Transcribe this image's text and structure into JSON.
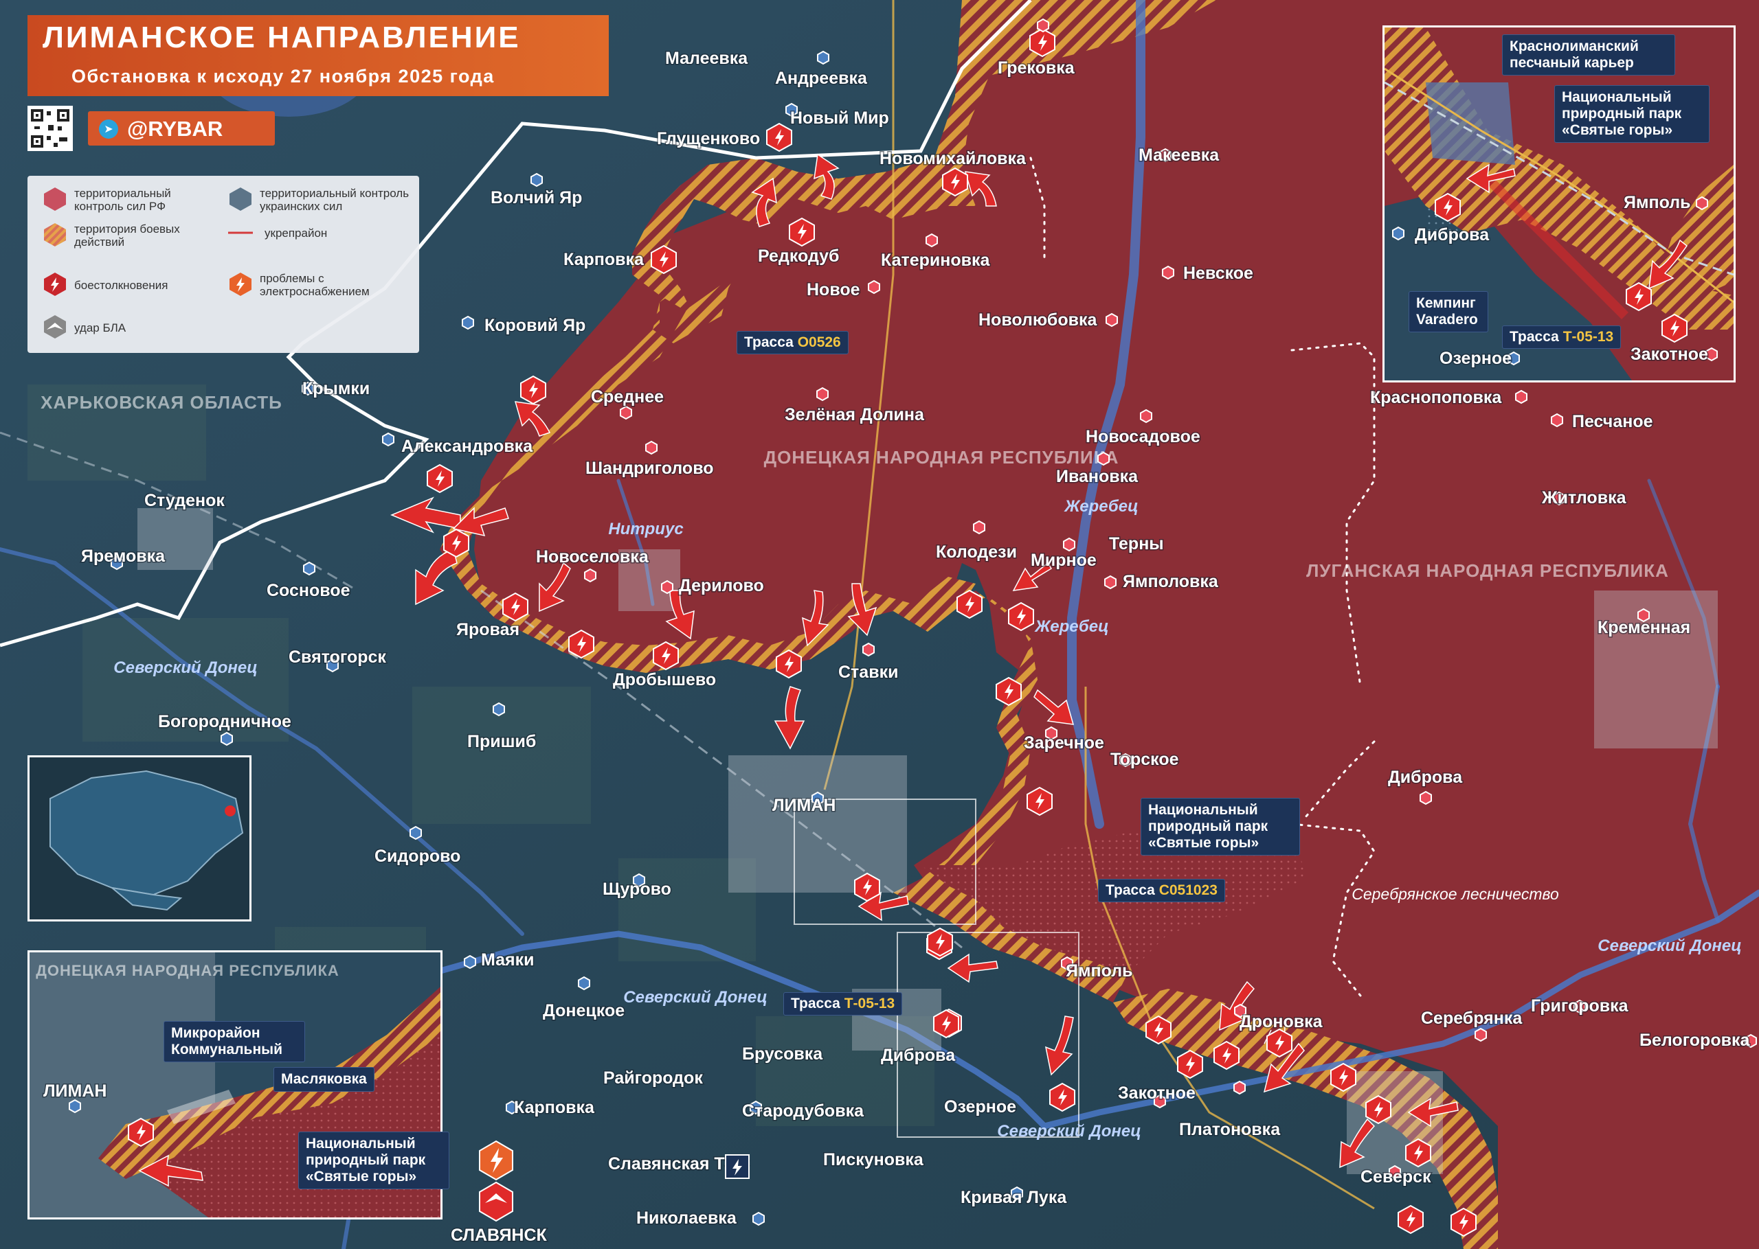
{
  "title": {
    "main": "ЛИМАНСКОЕ НАПРАВЛЕНИЕ",
    "subtitle": "Обстановка к исходу 27 ноября 2025 года",
    "brand": "@RYBAR"
  },
  "legend": {
    "ru_control": "территориальный контроль сил РФ",
    "ua_control": "территориальный контроль украинских сил",
    "combat": "территория боевых действий",
    "fortified": "укрепрайон",
    "clashes": "боестолкновения",
    "power": "проблемы с электроснабжением",
    "drone": "удар БЛА"
  },
  "colors": {
    "ru_fill": "#8b2e36",
    "ua_fill": "#2b4a5e",
    "combat_stripe": "#e0a040",
    "accent": "#d5562a",
    "clash_red": "#e02a2a"
  },
  "regions": [
    "ХАРЬКОВСКАЯ ОБЛАСТЬ",
    "ДОНЕЦКАЯ НАРОДНАЯ РЕСПУБЛИКА",
    "ЛУГАНСКАЯ НАРОДНАЯ РЕСПУБЛИКА"
  ],
  "rivers": [
    "Нитриус",
    "Жеребец",
    "Жеребец",
    "Северский Донец",
    "Северский Донец",
    "Северский Донец",
    "Северский Донец"
  ],
  "forest": "Серебрянское лесничество",
  "roads": {
    "o0526": {
      "prefix": "Трасса",
      "code": "О0526"
    },
    "c051023": {
      "prefix": "Трасса",
      "code": "С051023"
    },
    "t0513": {
      "prefix": "Трасса",
      "code": "Т-05-13"
    },
    "t0513_inset": {
      "prefix": "Трасса",
      "code": "Т-05-13"
    }
  },
  "callouts": {
    "park_main": "Национальный природный парк «Святые горы»",
    "quarry": "Краснолиманский песчаный карьер",
    "park_inset_tr": "Национальный природный парк «Святые горы»",
    "camping": "Кемпинг Varadero",
    "microdistrict": "Микрорайон Коммунальный",
    "maslyakovka": "Масляковка",
    "park_inset_bl": "Национальный природный парк «Святые горы»"
  },
  "inset_tr_places": [
    "Диброва",
    "Ямполь",
    "Озерное",
    "Закотное"
  ],
  "inset_bl_places": [
    "ЛИМАН",
    "ДОНЕЦКАЯ НАРОДНАЯ РЕСПУБЛИКА"
  ],
  "places": [
    "Малеевка",
    "Андреевка",
    "Новый Мир",
    "Глущенково",
    "Грековка",
    "Новомихайловка",
    "Макеевка",
    "Волчий Яр",
    "Карповка",
    "Редкодуб",
    "Катериновка",
    "Новое",
    "Невское",
    "Новолюбовка",
    "Коровий Яр",
    "Крымки",
    "Среднее",
    "Зелёная Долина",
    "Александровка",
    "Шандриголово",
    "Новосадовое",
    "Ивановка",
    "Студенок",
    "Яремовка",
    "Новоселовка",
    "Дерилово",
    "Колодези",
    "Мирное",
    "Терны",
    "Ямполовка",
    "Сосновое",
    "Яровая",
    "Святогорск",
    "Дробышево",
    "Ставки",
    "Богороднич­ное",
    "Пришиб",
    "Заречное",
    "Торское",
    "ЛИМАН",
    "Сидорово",
    "Щурово",
    "Маяки",
    "Донецкое",
    "Брусовка",
    "Райгородок",
    "Карповка",
    "Стародубовка",
    "Славянская ТЭС",
    "Пискуновка",
    "Кривая Лука",
    "Николаевка",
    "СЛАВЯНСК",
    "Диброва",
    "Озерное",
    "Ямполь",
    "Дроновка",
    "Закотное",
    "Платоновка",
    "Северск",
    "Серебрянка",
    "Григоровка",
    "Белогоровка",
    "Краснопоповка",
    "Песчаное",
    "Житловка",
    "Кременная",
    "Диброва"
  ]
}
